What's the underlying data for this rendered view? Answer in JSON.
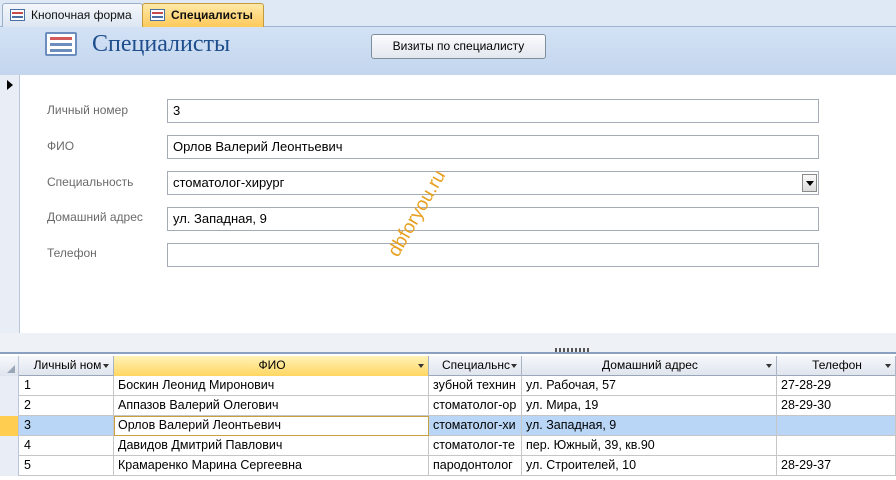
{
  "tabs": [
    {
      "label": "Кнопочная форма",
      "active": false
    },
    {
      "label": "Специалисты",
      "active": true
    }
  ],
  "header": {
    "title": "Специалисты",
    "button_label": "Визиты по специалисту"
  },
  "form": {
    "fields": [
      {
        "label": "Личный номер",
        "value": "3"
      },
      {
        "label": "ФИО",
        "value": "Орлов Валерий Леонтьевич"
      },
      {
        "label": "Специальность",
        "value": "стоматолог-хирург"
      },
      {
        "label": "Домашний адрес",
        "value": "ул. Западная, 9"
      },
      {
        "label": "Телефон",
        "value": ""
      }
    ]
  },
  "watermark": "dbforyou.ru",
  "grid": {
    "columns": [
      "Личный ном",
      "ФИО",
      "Специальнс",
      "Домашний адрес",
      "Телефон"
    ],
    "rows": [
      [
        "1",
        "Боскин Леонид Миронович",
        "зубной технин",
        "ул. Рабочая, 57",
        "27-28-29"
      ],
      [
        "2",
        "Аппазов Валерий Олегович",
        "стоматолог-ор",
        "ул. Мира, 19",
        "28-29-30"
      ],
      [
        "3",
        "Орлов Валерий Леонтьевич",
        "стоматолог-хи",
        "ул. Западная, 9",
        ""
      ],
      [
        "4",
        "Давидов Дмитрий Павлович",
        "стоматолог-те",
        "пер. Южный, 39, кв.90",
        ""
      ],
      [
        "5",
        "Крамаренко Марина Сергеевна",
        "пародонтолог",
        "ул. Строителей, 10",
        "28-29-37"
      ]
    ]
  },
  "colors": {
    "accent": "#ffc95a",
    "title": "#1f4e8c",
    "selection": "#b9d6f7"
  }
}
